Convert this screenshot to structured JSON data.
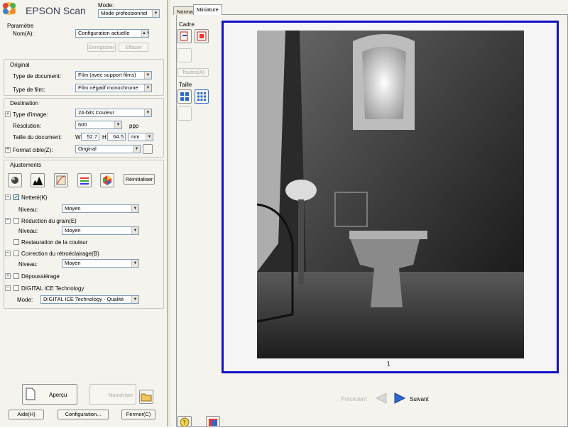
{
  "app": {
    "title": "EPSON Scan"
  },
  "mode": {
    "label": "Mode:",
    "value": "Mode professionnel"
  },
  "parametre": {
    "title": "Paramètre",
    "name_label": "Nom(A):",
    "name_value": "Configuration actuelle",
    "save_label": "Enregistrer",
    "delete_label": "Effacer"
  },
  "original": {
    "title": "Original",
    "doc_type_label": "Type de document:",
    "doc_type_value": "Film (avec support films)",
    "film_type_label": "Type de film:",
    "film_type_value": "Film négatif monochrome"
  },
  "destination": {
    "title": "Destination",
    "image_type_label": "Type d'image:",
    "image_type_value": "24-bits Couleur",
    "resolution_label": "Résolution:",
    "resolution_value": "600",
    "resolution_unit": "ppp",
    "doc_size_label": "Taille du document:",
    "w_label": "W",
    "w_value": "52.7",
    "h_label": "H",
    "h_value": "64.5",
    "size_unit": "mm",
    "target_format_label": "Format cible(Z):",
    "target_format_value": "Original"
  },
  "ajustements": {
    "title": "Ajustements",
    "reset_label": "Réinitialiser",
    "sharpness_label": "Netteté(K)",
    "sharpness_level_label": "Niveau:",
    "sharpness_level_value": "Moyen",
    "grain_label": "Réduction du grain(E)",
    "grain_level_label": "Niveau:",
    "grain_level_value": "Moyen",
    "color_restore_label": "Restauration de la couleur",
    "backlight_label": "Correction du rétroéclairage(B)",
    "backlight_level_label": "Niveau:",
    "backlight_level_value": "Moyen",
    "dust_label": "Dépoussiérage",
    "ice_label": "DIGITAL ICE Technology",
    "ice_mode_label": "Mode:",
    "ice_mode_value": "DIGITAL ICE Technology - Qualité"
  },
  "bottom": {
    "preview_label": "Aperçu",
    "scan_label": "Numériser",
    "help_label": "Aide(H)",
    "config_label": "Configuration...",
    "close_label": "Fermer(C)"
  },
  "preview_window": {
    "tab_normal": "Normal",
    "tab_thumbnail": "Miniature",
    "cadre_label": "Cadre",
    "all_label": "Toutes(A)",
    "taille_label": "Taille",
    "frame_number": "1",
    "previous_label": "Précédent",
    "next_label": "Suivant"
  }
}
